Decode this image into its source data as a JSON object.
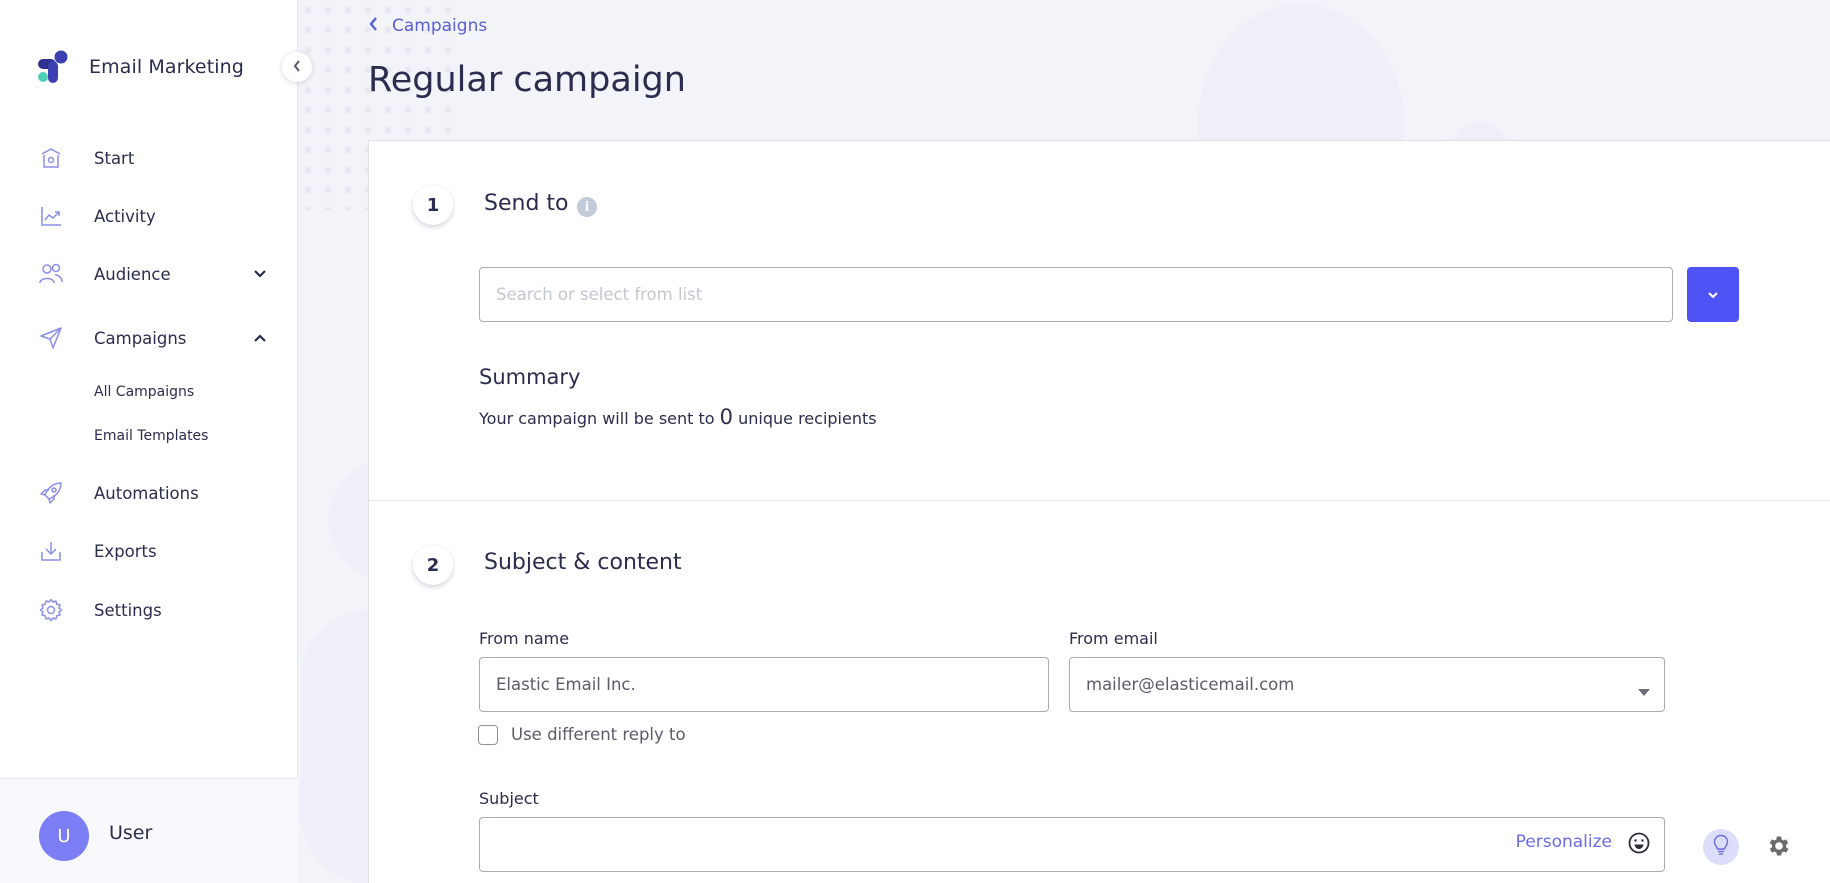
{
  "app": {
    "name": "Email Marketing",
    "accent_color": "#4f52f5"
  },
  "sidebar": {
    "collapse_icon": "chevron-left-icon",
    "items": [
      {
        "label": "Start",
        "icon": "home-icon"
      },
      {
        "label": "Activity",
        "icon": "chart-line-icon"
      },
      {
        "label": "Audience",
        "icon": "users-icon",
        "expanded": false
      },
      {
        "label": "Campaigns",
        "icon": "paper-plane-icon",
        "expanded": true
      },
      {
        "label": "Automations",
        "icon": "rocket-icon"
      },
      {
        "label": "Exports",
        "icon": "download-icon"
      },
      {
        "label": "Settings",
        "icon": "gear-icon"
      }
    ],
    "campaigns_subitems": [
      {
        "label": "All Campaigns"
      },
      {
        "label": "Email Templates"
      }
    ],
    "user": {
      "initial": "U",
      "name": "User"
    }
  },
  "header": {
    "back_label": "Campaigns",
    "title": "Regular campaign"
  },
  "steps": [
    {
      "number": "1",
      "title": "Send to",
      "search": {
        "placeholder": "Search or select from list",
        "value": ""
      },
      "summary": {
        "title": "Summary",
        "text_before": "Your campaign will be sent to",
        "count": "0",
        "text_after": "unique recipients"
      }
    },
    {
      "number": "2",
      "title": "Subject & content",
      "from_name": {
        "label": "From name",
        "value": "Elastic Email Inc."
      },
      "from_email": {
        "label": "From email",
        "value": "mailer@elasticemail.com"
      },
      "reply_to": {
        "label": "Use different reply to",
        "checked": false
      },
      "subject": {
        "label": "Subject",
        "value": "",
        "personalize_label": "Personalize"
      }
    }
  ]
}
